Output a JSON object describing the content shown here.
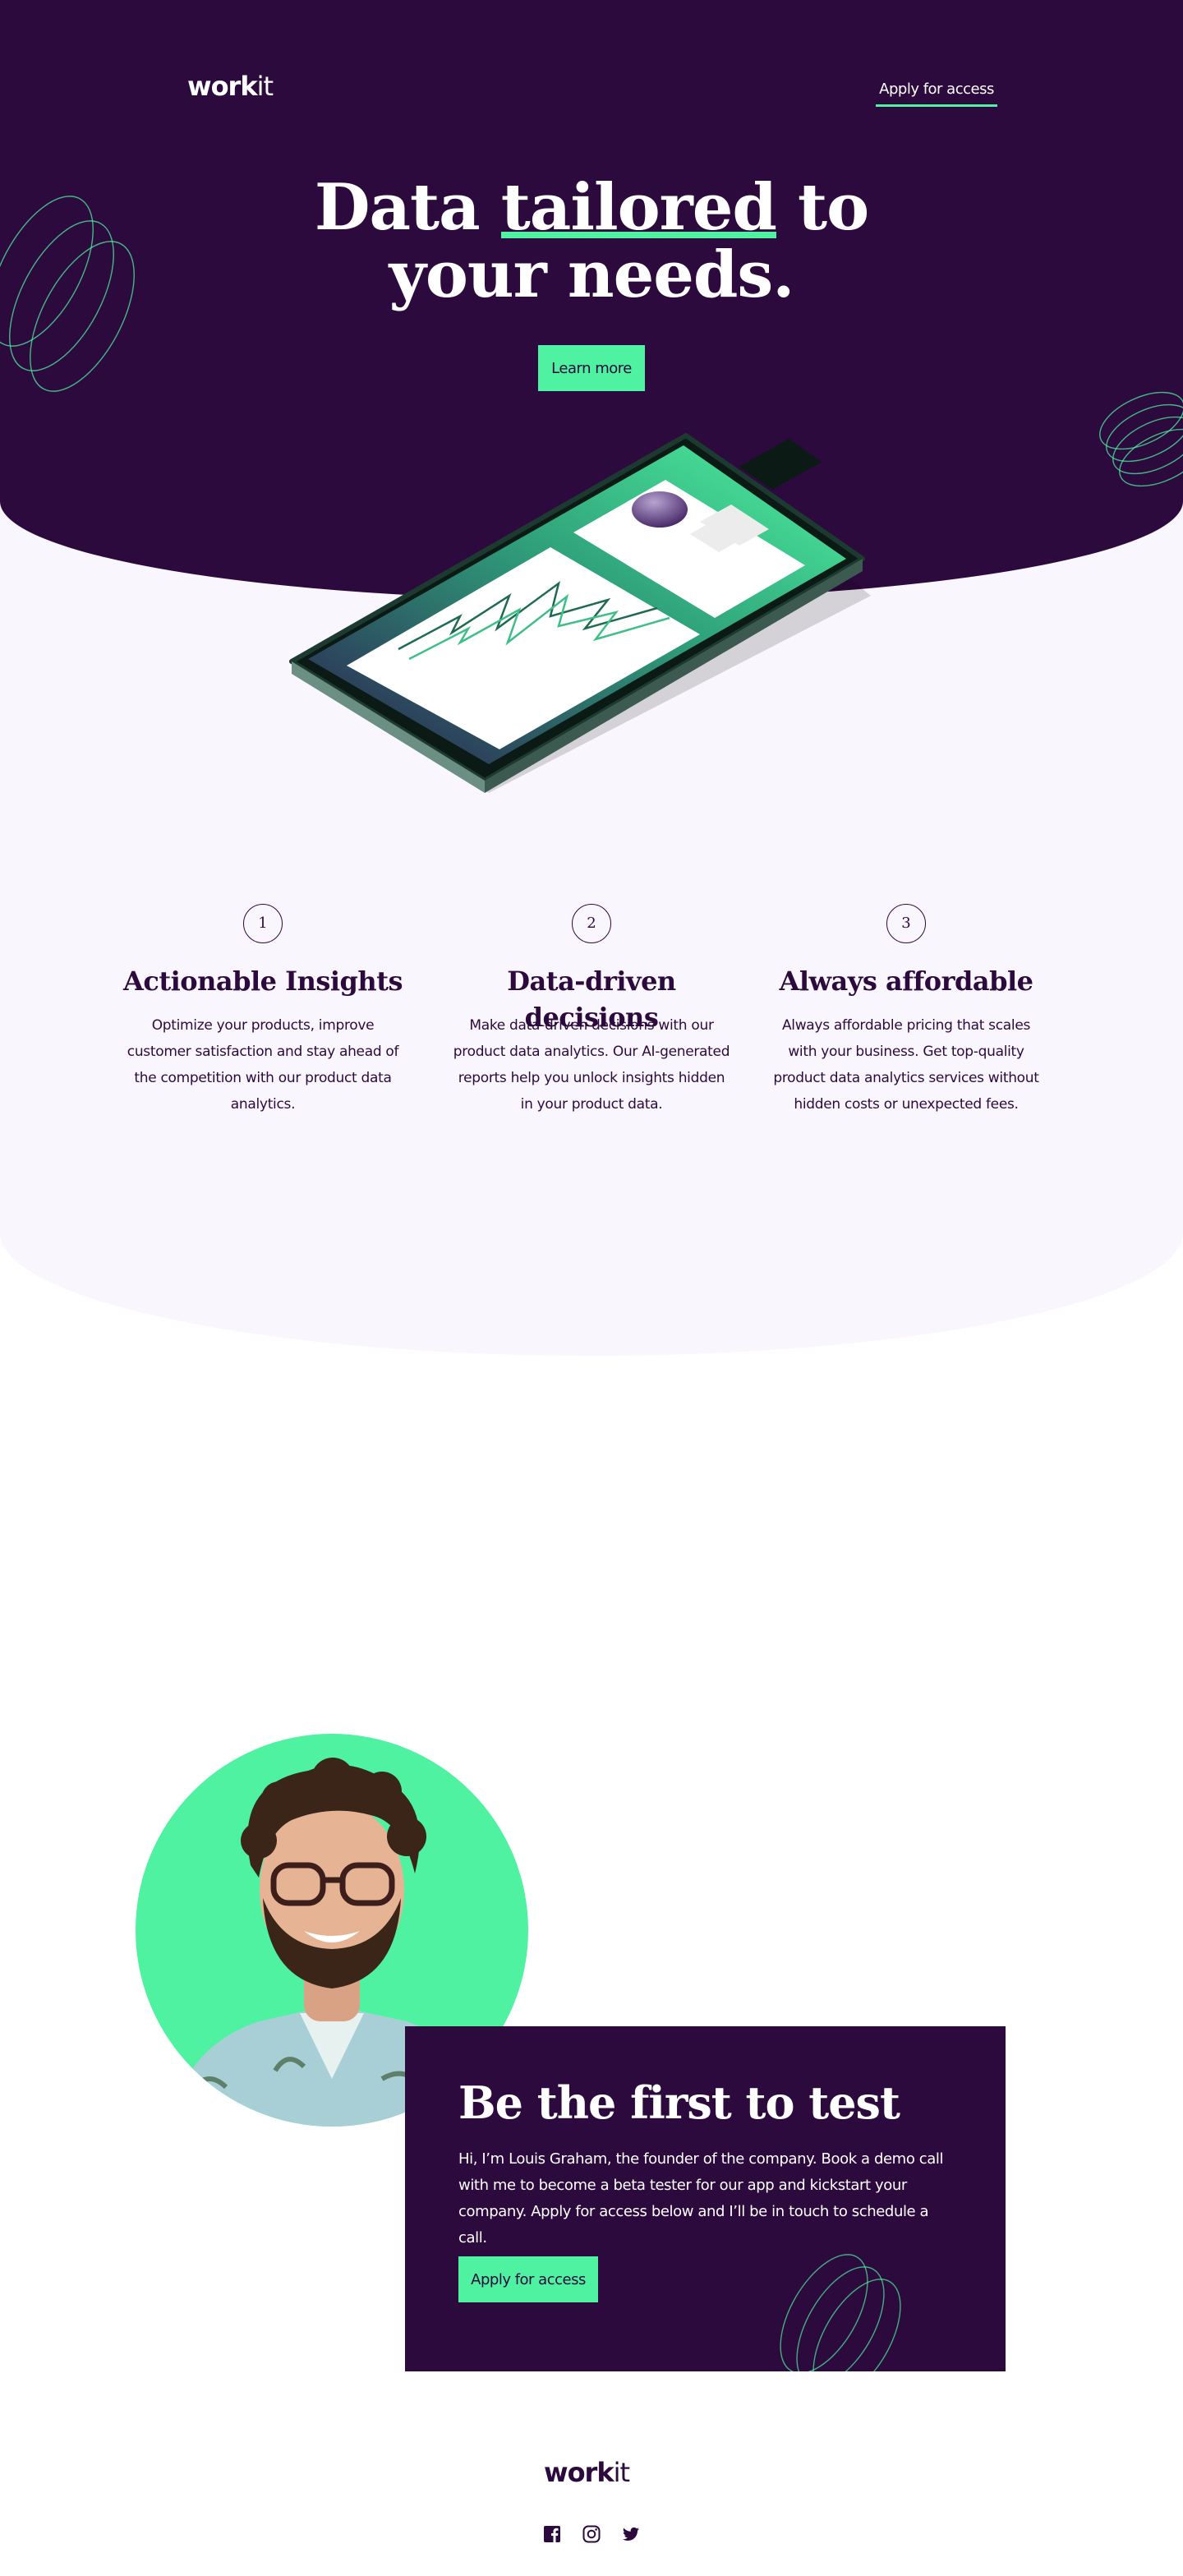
{
  "header": {
    "logo_bold": "work",
    "logo_light": "it",
    "apply_link": "Apply for access"
  },
  "hero": {
    "title_part1": "Data ",
    "title_highlight": "tailored",
    "title_part2": " to",
    "title_line2": "your needs.",
    "cta": "Learn more"
  },
  "features": [
    {
      "number": "1",
      "title": "Actionable Insights",
      "text": "Optimize your products, improve customer satisfaction and stay ahead of the competition with our product data analytics."
    },
    {
      "number": "2",
      "title": "Data-driven decisions",
      "text": "Make data-driven decisions with our product data analytics. Our AI-generated reports help you unlock insights hidden in your product data."
    },
    {
      "number": "3",
      "title": "Always affordable",
      "text": "Always affordable pricing that scales with your business. Get top-quality product data analytics services without hidden costs or unexpected fees."
    }
  ],
  "founder": {
    "title": "Be the first to test",
    "text": "Hi, I’m Louis Graham, the founder of the company. Book a demo call with me to become a beta tester for our app and kickstart your company. Apply for access below and I’ll be in touch to schedule a call.",
    "cta": "Apply for access"
  },
  "footer": {
    "logo_bold": "work",
    "logo_light": "it",
    "social": [
      "facebook-icon",
      "instagram-icon",
      "twitter-icon"
    ]
  },
  "colors": {
    "dark_purple": "#2c0a3d",
    "accent_green": "#4ef2a0",
    "light_bg": "#f9f6fd"
  }
}
